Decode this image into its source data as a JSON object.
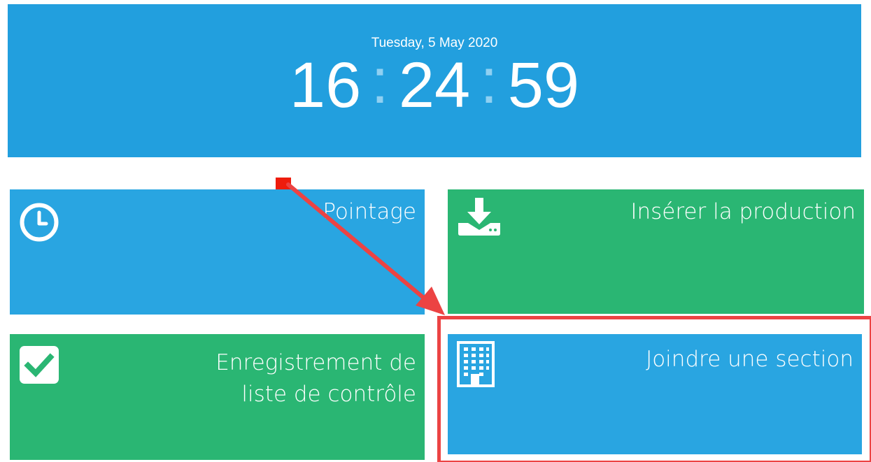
{
  "clock": {
    "date": "Tuesday, 5 May 2020",
    "hours": "16",
    "minutes": "24",
    "seconds": "59",
    "separator": ":"
  },
  "tiles": [
    {
      "label": "Pointage",
      "icon": "clock-icon",
      "color": "#29a5e1"
    },
    {
      "label": "Insérer la production",
      "icon": "download-tray-icon",
      "color": "#2ab673"
    },
    {
      "label_line1": "Enregistrement de",
      "label_line2": "liste de contrôle",
      "icon": "checkbox-icon",
      "color": "#2ab673"
    },
    {
      "label": "Joindre une section",
      "icon": "building-icon",
      "color": "#29a5e1"
    }
  ],
  "annotation": {
    "color": "#ec4343",
    "target": "tile-joindre-une-section"
  }
}
